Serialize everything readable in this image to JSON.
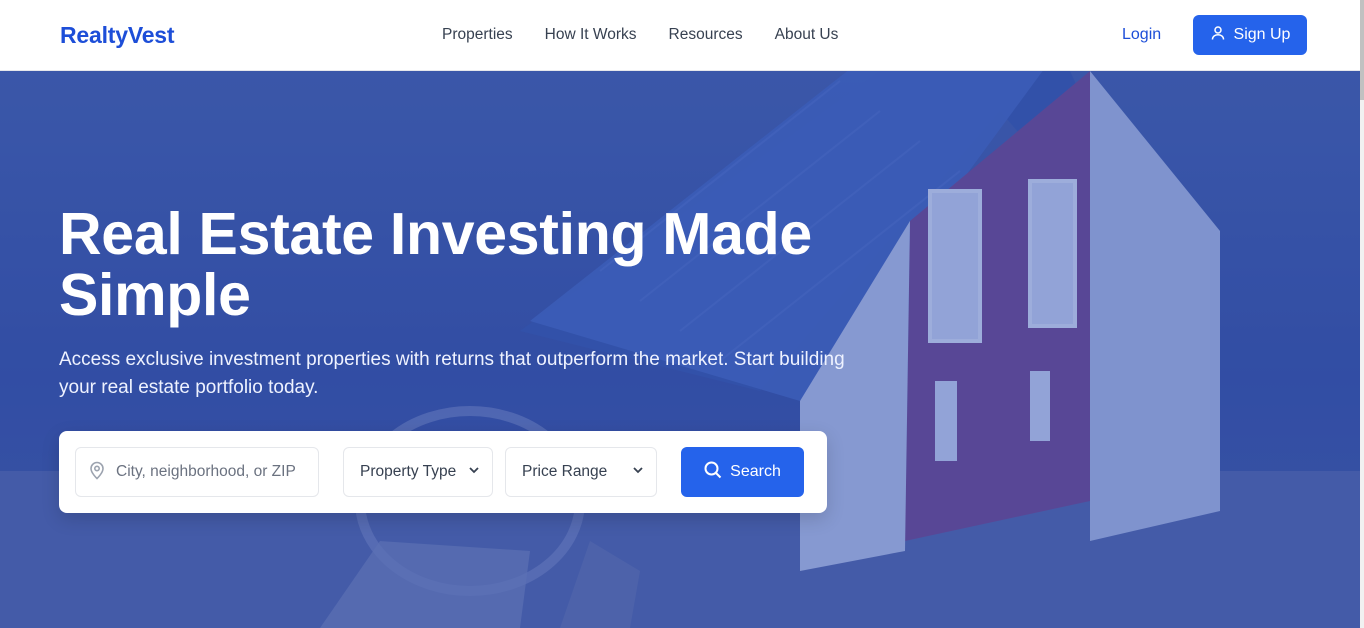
{
  "brand": {
    "name": "RealtyVest"
  },
  "nav": {
    "items": [
      {
        "label": "Properties"
      },
      {
        "label": "How It Works"
      },
      {
        "label": "Resources"
      },
      {
        "label": "About Us"
      }
    ],
    "login_label": "Login",
    "signup_label": "Sign Up"
  },
  "hero": {
    "headline": "Real Estate Investing Made Simple",
    "subtext": "Access exclusive investment properties with returns that outperform the market. Start building your real estate portfolio today."
  },
  "search": {
    "location_placeholder": "City, neighborhood, or ZIP",
    "property_type_selected": "Property Type",
    "price_range_selected": "Price Range",
    "button_label": "Search"
  },
  "icons": {
    "signup": "user-icon",
    "location": "map-pin-icon",
    "search": "search-icon",
    "dropdown": "chevron-down-icon"
  },
  "colors": {
    "brand": "#1d4ed8",
    "primary_button": "#2563eb",
    "hero_overlay": "#3c53a0"
  }
}
